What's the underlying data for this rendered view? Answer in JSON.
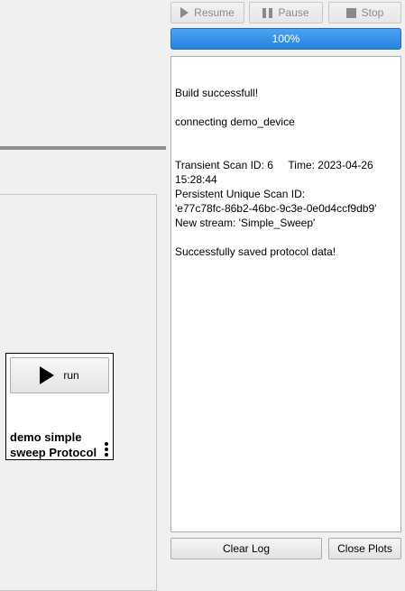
{
  "controls": {
    "resume": {
      "label": "Resume",
      "icon": "play-icon"
    },
    "pause": {
      "label": "Pause",
      "icon": "pause-icon"
    },
    "stop": {
      "label": "Stop",
      "icon": "stop-icon"
    }
  },
  "progress": {
    "label": "100%",
    "value": 1.0,
    "color": "#2b87dd"
  },
  "log": {
    "lines": [
      "",
      "",
      "Build successfull!",
      "",
      "connecting demo_device",
      "",
      "",
      "Transient Scan ID: 6     Time: 2023-04-26",
      "15:28:44",
      "Persistent Unique Scan ID:",
      "'e77c78fc-86b2-46bc-9c3e-0e0d4ccf9db9'",
      "New stream: 'Simple_Sweep'",
      "",
      "Successfully saved protocol data!"
    ]
  },
  "footer": {
    "clear_log": "Clear Log",
    "close_plots": "Close Plots"
  },
  "protocol": {
    "run_label": "run",
    "run_icon": "play-icon",
    "name": "demo simple sweep Protocol",
    "menu_icon": "kebab-menu-icon"
  }
}
